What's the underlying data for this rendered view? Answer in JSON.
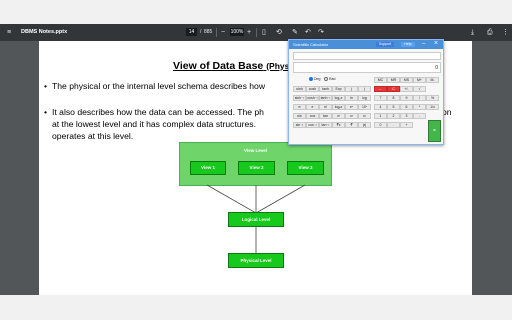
{
  "toolbar": {
    "title": "DBMS Notes.pptx",
    "current_page": "14",
    "page_separator": "/",
    "total_pages": "885",
    "zoom": "100%"
  },
  "slide": {
    "title": "View of Data Base",
    "title_suffix": "(Phys",
    "bullets": [
      "The physical or the internal level schema describes how",
      "It also describes how the data can be accessed. The ph",
      "at the lowest level and it has complex data structures.",
      "operates at this level."
    ],
    "bullet_tail": "on",
    "bullet_glyph": "•"
  },
  "diagram": {
    "view_level": "View Level",
    "views": [
      "View 1",
      "View 2",
      "View 3"
    ],
    "logical_level": "Logical Level",
    "physical_level": "Physical Level",
    "fill_color": "#6fd46a",
    "box_color": "#16c91c"
  },
  "calculator": {
    "title": "Scientific Calculator",
    "support_label": "Support",
    "help_label": "Help",
    "display": "0",
    "mode_deg": "Deg",
    "mode_rad": "Rad",
    "rows": [
      [
        "MC",
        "MR",
        "MS",
        "M+",
        "M-"
      ],
      [
        "sinh",
        "cosh",
        "tanh",
        "Exp",
        "(",
        ")",
        "←",
        "C",
        "+/-",
        "√"
      ],
      [
        "sinh⁻¹",
        "cosh⁻¹",
        "tanh⁻¹",
        "log₂x",
        "ln",
        "log",
        "7",
        "8",
        "9",
        "/",
        "%"
      ],
      [
        "π",
        "e",
        "n!",
        "logᵧx",
        "eˣ",
        "10ˣ",
        "4",
        "5",
        "6",
        "*",
        "1/x"
      ],
      [
        "sin",
        "cos",
        "tan",
        "xʸ",
        "x³",
        "x²",
        "1",
        "2",
        "3",
        "-"
      ],
      [
        "sin⁻¹",
        "cos⁻¹",
        "tan⁻¹",
        "∛x",
        "∛",
        "|x|",
        "0",
        ".",
        "+"
      ]
    ],
    "equals": "="
  },
  "colors": {
    "toolbar": "#323639",
    "calc_header": "#4a90d9"
  }
}
